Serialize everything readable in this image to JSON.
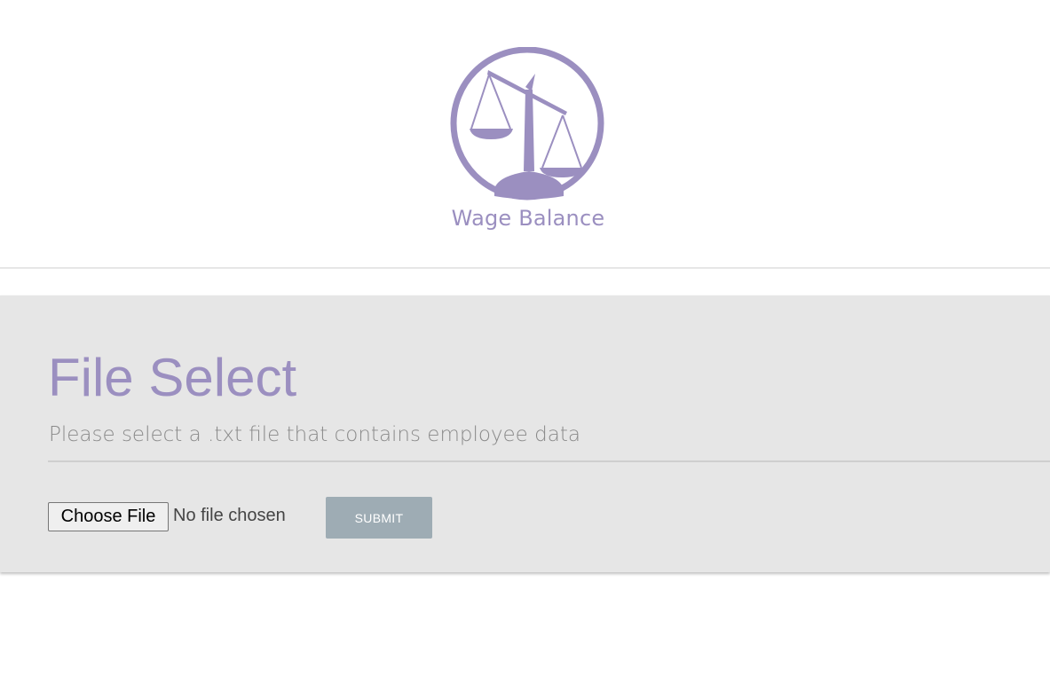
{
  "brand": {
    "name": "Wage Balance",
    "color": "#9b8fc0",
    "icon": "scales-of-justice-icon"
  },
  "panel": {
    "title": "File Select",
    "subtitle": "Please select a .txt file that contains employee data",
    "background": "#e6e6e6"
  },
  "file_input": {
    "button_label": "Choose File",
    "status": "No file chosen"
  },
  "submit": {
    "label": "SUBMIT",
    "color": "#9eacb4"
  }
}
